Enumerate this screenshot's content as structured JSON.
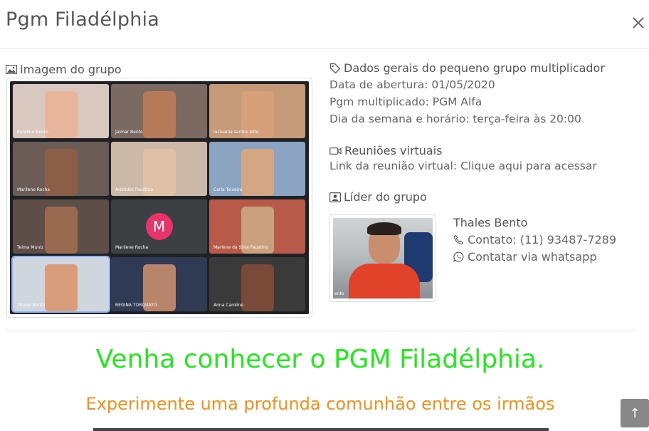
{
  "modal": {
    "title": "Pgm Filadélphia",
    "close_label": "×"
  },
  "image_section": {
    "title": "Imagem do grupo",
    "participants": [
      "Karoline Bento",
      "Jaimar Bento",
      "lucivania santos leite",
      "Marilene Rocha",
      "Aristides Faustino",
      "Carla Teixeira",
      "Telma Muniz",
      "Marilene Rocha",
      "Marlene da Silva Faustino",
      "Thales Bento",
      "REGINA TORQUATO",
      "Anna Caroline"
    ],
    "avatar_letter": "M"
  },
  "general": {
    "title": "Dados gerais do pequeno grupo multiplicador",
    "opening_date": "Data de abertura: 01/05/2020",
    "multiplied": "Pgm multiplicado: PGM Alfa",
    "schedule": "Dia da semana e horário: terça-feira às 20:00"
  },
  "virtual": {
    "title": "Reuniões virtuais",
    "link_text": "Link da reunião virtual: Clique aqui para acessar"
  },
  "leader": {
    "title": "Líder do grupo",
    "name": "Thales Bento",
    "contact": "Contato: (11) 93487-7289",
    "whatsapp": "Contatar via whatsapp",
    "photo_caption": "ento"
  },
  "promo": {
    "title": "Venha conhecer o PGM Filadélphia.",
    "subtitle": "Experimente uma profunda comunhão entre os irmãos"
  },
  "scroll_top_label": "↑",
  "colors": {
    "promo_title": "#22e81d",
    "promo_subtitle": "#f39019"
  }
}
